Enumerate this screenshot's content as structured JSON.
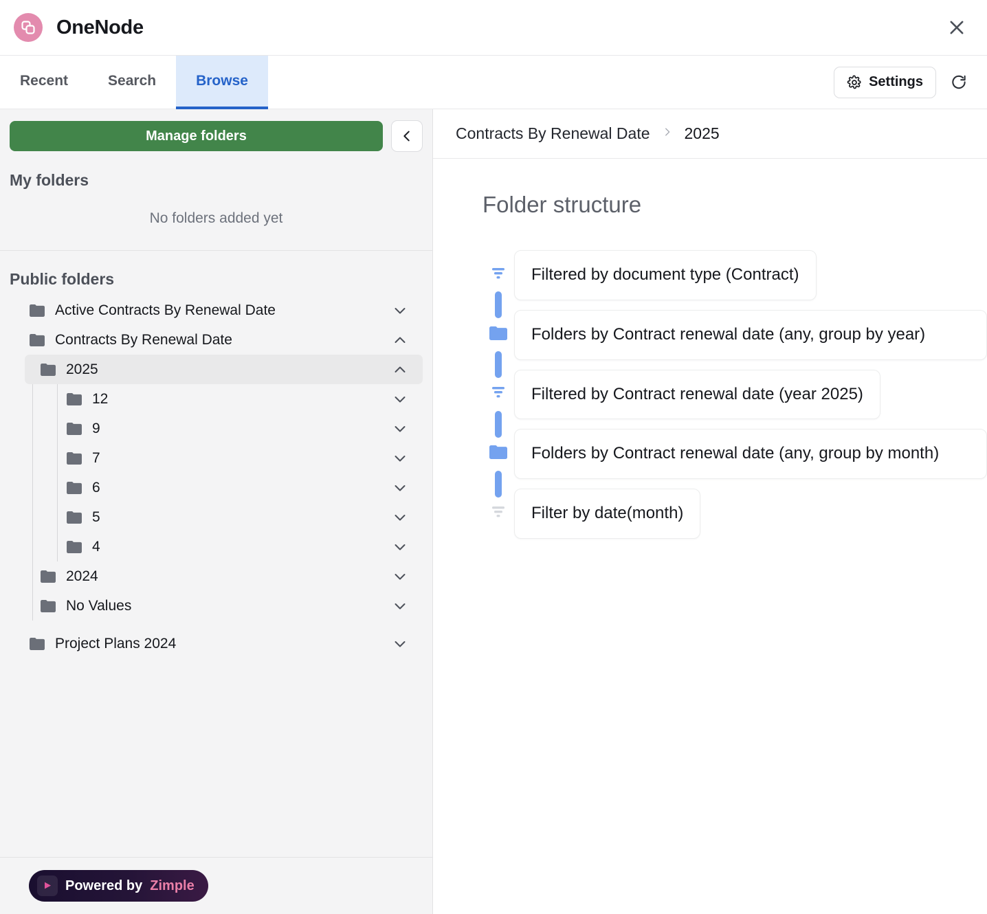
{
  "window": {
    "app_title": "OneNode",
    "logo_icon": "onenode-logo-icon",
    "close_icon": "close-icon",
    "brand_color": "#e38bae"
  },
  "tabs": {
    "items": [
      {
        "label": "Recent",
        "active": false
      },
      {
        "label": "Search",
        "active": false
      },
      {
        "label": "Browse",
        "active": true
      }
    ],
    "active_color": "#2563c9",
    "active_bg": "#ddeafb"
  },
  "toolbar": {
    "settings_label": "Settings",
    "settings_icon": "gear-icon",
    "refresh_icon": "refresh-icon"
  },
  "sidebar": {
    "manage_button": "Manage folders",
    "manage_button_color": "#42854a",
    "collapse_icon": "chevron-left-icon",
    "my_folders_title": "My folders",
    "my_folders_empty": "No folders added yet",
    "public_folders_title": "Public folders",
    "tree": [
      {
        "label": "Active Contracts By Renewal Date",
        "level": 0,
        "expanded": false,
        "selected": false,
        "chevron": "chevron-down-icon"
      },
      {
        "label": "Contracts By Renewal Date",
        "level": 0,
        "expanded": true,
        "selected": false,
        "chevron": "chevron-up-icon"
      },
      {
        "label": "2025",
        "level": 1,
        "expanded": true,
        "selected": true,
        "chevron": "chevron-up-icon"
      },
      {
        "label": "12",
        "level": 2,
        "expanded": false,
        "selected": false,
        "chevron": "chevron-down-icon"
      },
      {
        "label": "9",
        "level": 2,
        "expanded": false,
        "selected": false,
        "chevron": "chevron-down-icon"
      },
      {
        "label": "7",
        "level": 2,
        "expanded": false,
        "selected": false,
        "chevron": "chevron-down-icon"
      },
      {
        "label": "6",
        "level": 2,
        "expanded": false,
        "selected": false,
        "chevron": "chevron-down-icon"
      },
      {
        "label": "5",
        "level": 2,
        "expanded": false,
        "selected": false,
        "chevron": "chevron-down-icon"
      },
      {
        "label": "4",
        "level": 2,
        "expanded": false,
        "selected": false,
        "chevron": "chevron-down-icon"
      },
      {
        "label": "2024",
        "level": 1,
        "expanded": false,
        "selected": false,
        "chevron": "chevron-down-icon"
      },
      {
        "label": "No Values",
        "level": 1,
        "expanded": false,
        "selected": false,
        "chevron": "chevron-down-icon"
      },
      {
        "label": "Project Plans 2024",
        "level": 0,
        "expanded": false,
        "selected": false,
        "chevron": "chevron-down-icon"
      }
    ],
    "footer": {
      "prefix": "Powered by ",
      "brand": "Zimple",
      "play_icon": "play-icon",
      "brand_color": "#ea7fa8"
    }
  },
  "main": {
    "breadcrumb": [
      {
        "label": "Contracts By Renewal Date",
        "current": false
      },
      {
        "label": "2025",
        "current": true
      }
    ],
    "breadcrumb_separator": "›",
    "panel_title": "Folder structure",
    "flow_accent": "#74a2ef",
    "flow_steps": [
      {
        "icon": "filter-icon",
        "icon_state": "active",
        "text": "Filtered by document type (Contract)",
        "width": "auto"
      },
      {
        "icon": "folder-icon",
        "icon_state": "active",
        "text": "Folders by Contract renewal date (any, group by year)",
        "width": "wide"
      },
      {
        "icon": "filter-icon",
        "icon_state": "active",
        "text": "Filtered by Contract renewal date (year 2025)",
        "width": "auto"
      },
      {
        "icon": "folder-icon",
        "icon_state": "active",
        "text": "Folders by Contract renewal date (any, group by month)",
        "width": "wide"
      },
      {
        "icon": "filter-icon",
        "icon_state": "inactive",
        "text": "Filter by date(month)",
        "width": "auto"
      }
    ]
  }
}
